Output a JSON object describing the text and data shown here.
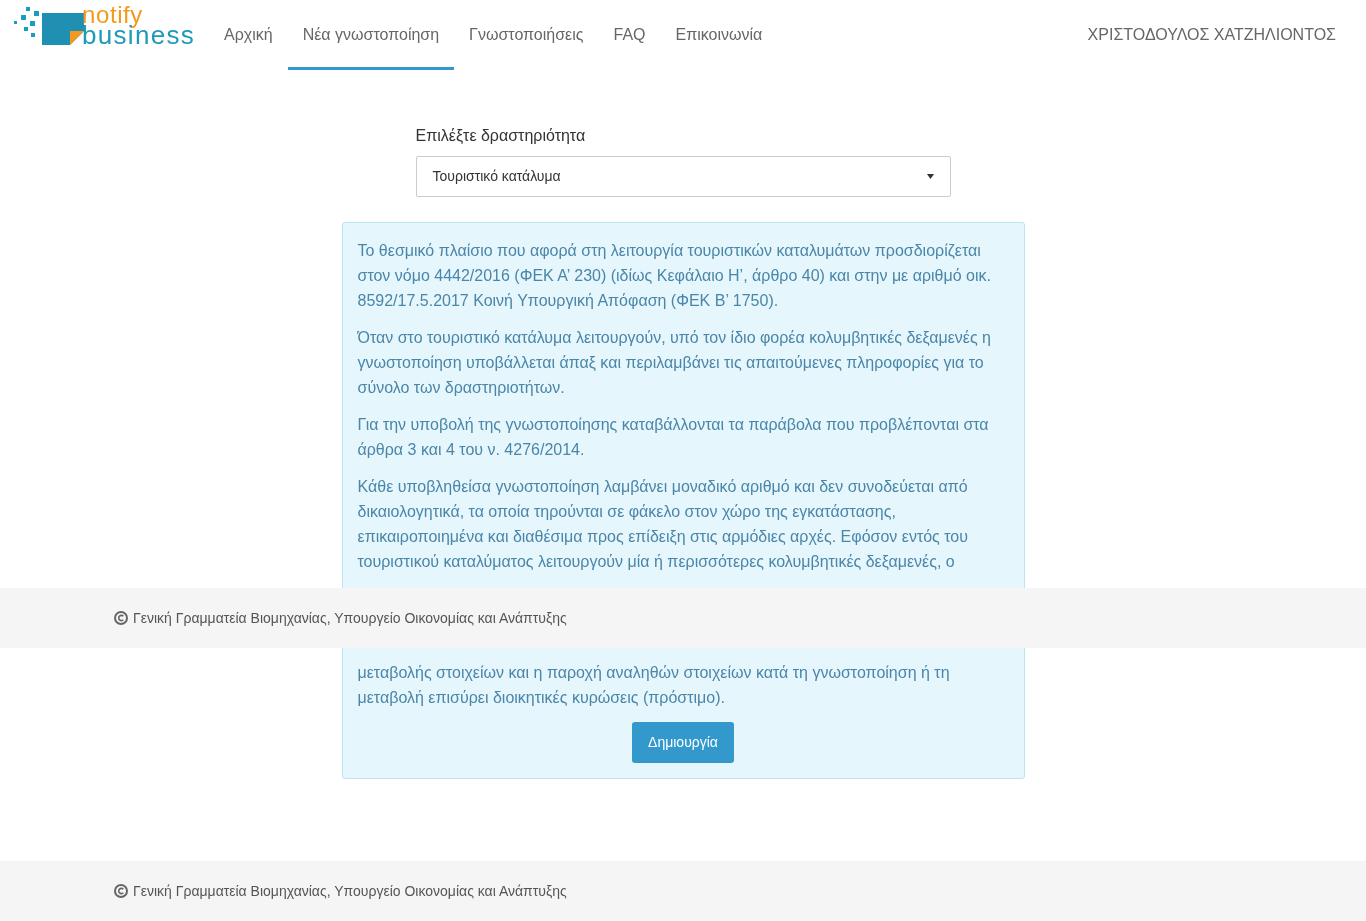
{
  "logo": {
    "line1": "notify",
    "line2": "business"
  },
  "nav": [
    {
      "label": "Αρχική",
      "selected": false
    },
    {
      "label": "Νέα γνωστοποίηση",
      "selected": true
    },
    {
      "label": "Γνωστοποιήσεις",
      "selected": false
    },
    {
      "label": "FAQ",
      "selected": false
    },
    {
      "label": "Επικοινωνία",
      "selected": false
    }
  ],
  "user": "ΧΡΙΣΤΟΔΟΥΛΟΣ ΧΑΤΖΗΛΙΟΝΤΟΣ",
  "activity": {
    "label": "Επιλέξτε δραστηριότητα",
    "value": "Τουριστικό κατάλυμα"
  },
  "info": {
    "paragraphs": [
      "Το θεσμικό πλαίσιο που αφορά στη λειτουργία τουριστικών καταλυμάτων προσδιορίζεται στον νόμο 4442/2016 (ΦΕΚ Α’ 230) (ιδίως Κεφάλαιο Η’, άρθρο 40) και στην με αριθμό οικ. 8592/17.5.2017 Κοινή Υπουργική Απόφαση (ΦΕΚ Β’ 1750).",
      "Όταν στο τουριστικό κατάλυμα λειτουργούν, υπό τον ίδιο φορέα κολυμβητικές δεξαμενές η γνωστοποίηση υποβάλλεται άπαξ και περιλαμβάνει τις απαιτούμενες πληροφορίες για το σύνολο των δραστηριοτήτων.",
      "Για την υποβολή της γνωστοποίησης καταβάλλονται τα παράβολα που προβλέπονται στα άρθρα 3 και 4 του ν. 4276/2014.",
      "Κάθε υποβληθείσα γνωστοποίηση λαμβάνει μοναδικό αριθμό και δεν συνοδεύεται από δικαιολογητικά, τα οποία τηρούνται σε φάκελο στον χώρο της εγκατάστασης, επικαιροποιημένα και διαθέσιμα προς επίδειξη στις αρμόδιες αρχές. Εφόσον εντός του τουριστικού καταλύματος λειτουργούν μία ή περισσότερες κολυμβητικές δεξαμενές, ο"
    ],
    "after_overlay": "μεταβολής στοιχείων και η παροχή αναληθών στοιχείων κατά τη γνωστοποίηση ή τη μεταβολή επισύρει διοικητικές κυρώσεις (πρόστιμο).",
    "button": "Δημιουργία"
  },
  "footers": [
    "Γενική Γραμματεία Βιομηχανίας, Υπουργείο Οικονομίας και Ανάπτυξης",
    "Γενική Γραμματεία Βιομηχανίας, Υπουργείο Οικονομίας και Ανάπτυξης"
  ]
}
